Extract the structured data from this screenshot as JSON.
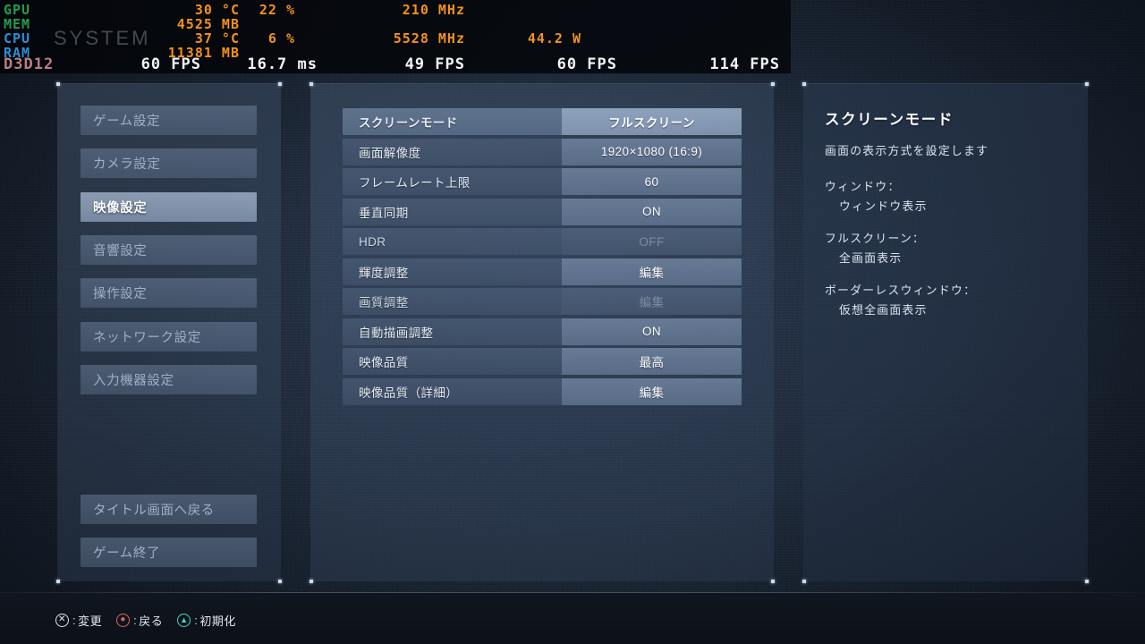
{
  "hw_overlay": {
    "watermark": "SYSTEM",
    "rows": [
      {
        "label": "GPU",
        "label_color": "#1f9e52",
        "cells": [
          {
            "text": "30 °C",
            "color": "#f59119"
          },
          {
            "text": "22 %",
            "color": "#f59119"
          },
          {
            "text": "210 MHz",
            "color": "#f59119"
          }
        ]
      },
      {
        "label": "MEM",
        "label_color": "#1f9e52",
        "cells": [
          {
            "text": "4525 MB",
            "color": "#f59119"
          }
        ]
      },
      {
        "label": "CPU",
        "label_color": "#2a8fd6",
        "cells": [
          {
            "text": "37 °C",
            "color": "#f59119"
          },
          {
            "text": "6 %",
            "color": "#f59119"
          },
          {
            "text": "5528 MHz",
            "color": "#f59119"
          },
          {
            "text": "44.2 W",
            "color": "#f59119"
          }
        ]
      },
      {
        "label": "RAM",
        "label_color": "#2a8fd6",
        "cells": [
          {
            "text": "11381 MB",
            "color": "#f59119"
          }
        ]
      },
      {
        "label": "D3D12",
        "label_color": "#b97f86",
        "cells": [
          {
            "text": "60 FPS",
            "color": "#f2f4f6"
          },
          {
            "text": "16.7 ms",
            "color": "#f2f4f6"
          },
          {
            "text": "49 FPS",
            "color": "#f2f4f6"
          },
          {
            "text": "60 FPS",
            "color": "#f2f4f6"
          },
          {
            "text": "114 FPS",
            "color": "#f2f4f6"
          }
        ]
      }
    ]
  },
  "sidebar": {
    "items": [
      {
        "label": "ゲーム設定",
        "active": false
      },
      {
        "label": "カメラ設定",
        "active": false
      },
      {
        "label": "映像設定",
        "active": true
      },
      {
        "label": "音響設定",
        "active": false
      },
      {
        "label": "操作設定",
        "active": false
      },
      {
        "label": "ネットワーク設定",
        "active": false
      },
      {
        "label": "入力機器設定",
        "active": false
      }
    ],
    "bottom_items": [
      {
        "label": "タイトル画面へ戻る"
      },
      {
        "label": "ゲーム終了"
      }
    ]
  },
  "settings": {
    "rows": [
      {
        "label": "スクリーンモード",
        "value": "フルスクリーン",
        "selected": true,
        "disabled": false
      },
      {
        "label": "画面解像度",
        "value": "1920×1080 (16:9)",
        "selected": false,
        "disabled": false
      },
      {
        "label": "フレームレート上限",
        "value": "60",
        "selected": false,
        "disabled": false
      },
      {
        "label": "垂直同期",
        "value": "ON",
        "selected": false,
        "disabled": false
      },
      {
        "label": "HDR",
        "value": "OFF",
        "selected": false,
        "disabled": true
      },
      {
        "label": "輝度調整",
        "value": "編集",
        "selected": false,
        "disabled": false
      },
      {
        "label": "画質調整",
        "value": "編集",
        "selected": false,
        "disabled": true
      },
      {
        "label": "自動描画調整",
        "value": "ON",
        "selected": false,
        "disabled": false
      },
      {
        "label": "映像品質",
        "value": "最高",
        "selected": false,
        "disabled": false
      },
      {
        "label": "映像品質（詳細）",
        "value": "編集",
        "selected": false,
        "disabled": false
      }
    ]
  },
  "description": {
    "title": "スクリーンモード",
    "subtitle": "画面の表示方式を設定します",
    "items": [
      {
        "heading": "ウィンドウ：",
        "body": "ウィンドウ表示"
      },
      {
        "heading": "フルスクリーン：",
        "body": "全画面表示"
      },
      {
        "heading": "ボーダーレスウィンドウ：",
        "body": "仮想全画面表示"
      }
    ]
  },
  "footer": {
    "hints": [
      {
        "glyph": "cross-button-icon",
        "symbol": "✕",
        "label": "変更"
      },
      {
        "glyph": "circle-button-icon",
        "symbol": "●",
        "label": "戻る"
      },
      {
        "glyph": "triangle-button-icon",
        "symbol": "▲",
        "label": "初期化"
      }
    ],
    "separator": ":"
  },
  "colors": {
    "accent_green": "#1f9e52",
    "accent_blue": "#2a8fd6",
    "accent_orange": "#f59119",
    "accent_pink": "#b97f86",
    "panel_blue": "#4e617c",
    "background": "#1d2838"
  }
}
